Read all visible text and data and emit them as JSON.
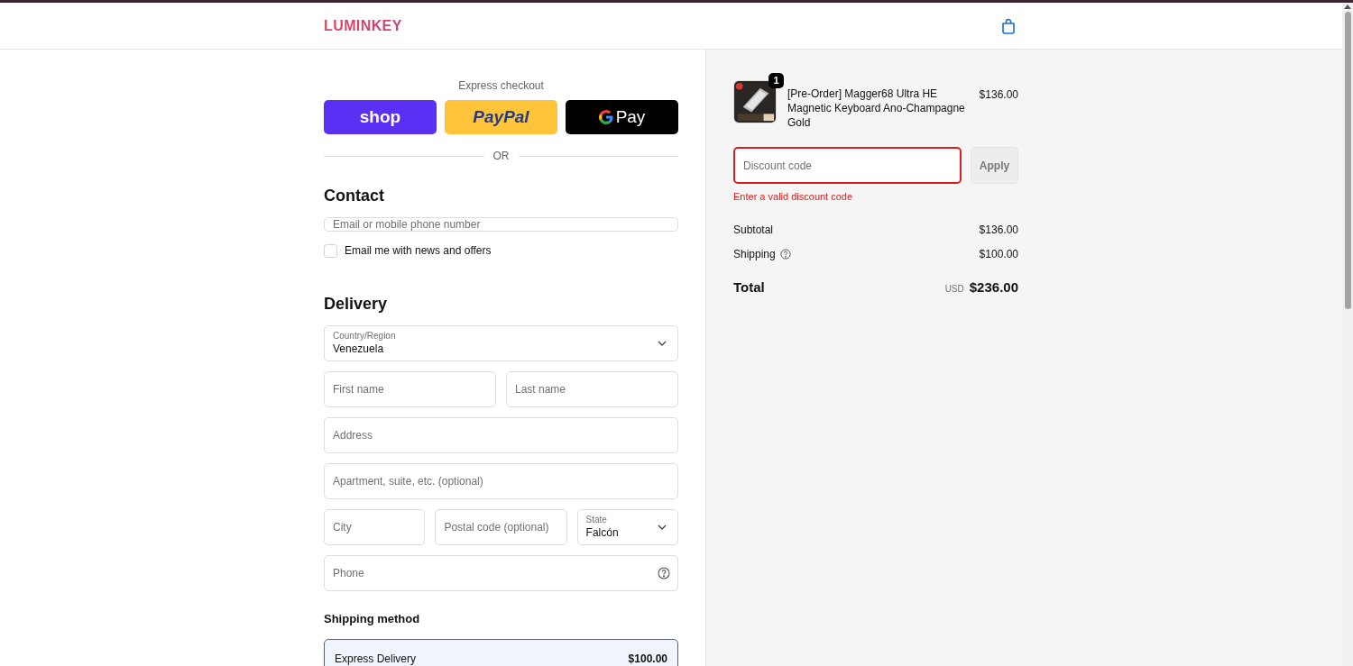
{
  "header": {
    "logo": "LUMINKEY"
  },
  "express_checkout": {
    "label": "Express checkout",
    "buttons": [
      {
        "kind": "shop",
        "label": "shop"
      },
      {
        "kind": "paypal",
        "label": "PayPal"
      },
      {
        "kind": "gpay",
        "label": "Pay"
      }
    ],
    "separator": "OR"
  },
  "contact": {
    "heading": "Contact",
    "email_placeholder": "Email or mobile phone number",
    "newsletter": {
      "label": "Email me with news and offers",
      "checked": false
    }
  },
  "delivery": {
    "heading": "Delivery",
    "rows": [
      [
        {
          "kind": "select",
          "label": "Country/Region",
          "value": "Venezuela"
        }
      ],
      [
        {
          "kind": "text",
          "placeholder": "First name"
        },
        {
          "kind": "text",
          "placeholder": "Last name"
        }
      ],
      [
        {
          "kind": "text",
          "placeholder": "Address"
        }
      ],
      [
        {
          "kind": "text",
          "placeholder": "Apartment, suite, etc. (optional)"
        }
      ],
      [
        {
          "kind": "text",
          "placeholder": "City"
        },
        {
          "kind": "text",
          "placeholder": "Postal code (optional)"
        },
        {
          "kind": "select",
          "label": "State",
          "value": "Falcón"
        }
      ],
      [
        {
          "kind": "help",
          "placeholder": "Phone"
        }
      ]
    ]
  },
  "shipping_method": {
    "heading": "Shipping method",
    "options": [
      {
        "name": "Express Delivery",
        "price": "$100.00",
        "selected": true
      }
    ]
  },
  "summary": {
    "item": {
      "name": "[Pre-Order] Magger68 Ultra HE Magnetic Keyboard Ano-Champagne Gold",
      "quantity": "1",
      "price": "$136.00"
    },
    "discount": {
      "placeholder": "Discount code",
      "button": "Apply",
      "error": true,
      "error_text": "Enter a valid discount code"
    },
    "lines": [
      {
        "label": "Subtotal",
        "value": "$136.00",
        "help": false
      },
      {
        "label": "Shipping",
        "value": "$100.00",
        "help": true
      }
    ],
    "total": {
      "label": "Total",
      "currency": "USD",
      "value": "$236.00"
    }
  }
}
